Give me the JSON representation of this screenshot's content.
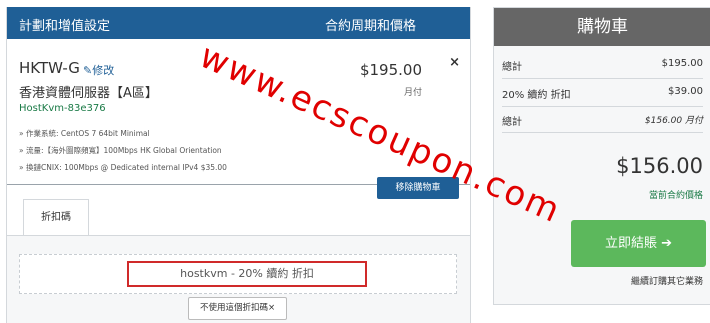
{
  "header": {
    "title": "計劃和增值設定",
    "cycle_col": "合約周期和價格"
  },
  "item": {
    "name": "HKTW-G",
    "edit": "✎修改",
    "desc": "香港資體伺服器【A區】",
    "hostname": "HostKvm-83e376",
    "configs": [
      "» 作業系統: CentOS 7 64bit Minimal",
      "» 流量:【海外圖際頻寬】100Mbps HK Global Orientation",
      "» 換鏈CNIX: 100Mbps @ Dedicated internal IPv4 $35.00"
    ],
    "price": "$195.00",
    "cycle": "月付",
    "close": "×",
    "remove": "移除購物車"
  },
  "promo": {
    "tab": "折扣碼",
    "code": "hostkvm - 20% 續約 折扣",
    "remove_btn": "不使用這個折扣碼×"
  },
  "cart": {
    "title": "購物車",
    "subtotal_label": "總計",
    "subtotal_value": "$195.00",
    "discount_label": "20% 續約 折扣",
    "discount_value": "$39.00",
    "recurring_label": "總計",
    "recurring_value": "$156.00 月付",
    "total": "$156.00",
    "total_note": "當前合約價格",
    "checkout": "立即結賬 ➔",
    "continue": "繼續訂購其它業務"
  },
  "watermark": "www.ecscoupon.com"
}
